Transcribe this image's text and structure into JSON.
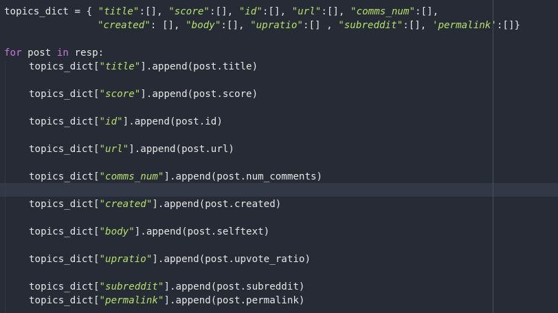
{
  "editor": {
    "lines": [
      {
        "segments": [
          {
            "t": "topics_dict = { ",
            "c": "var"
          },
          {
            "t": "\"title\"",
            "c": "str"
          },
          {
            "t": ":[], ",
            "c": "var"
          },
          {
            "t": "\"score\"",
            "c": "str"
          },
          {
            "t": ":[], ",
            "c": "var"
          },
          {
            "t": "\"id\"",
            "c": "str"
          },
          {
            "t": ":[], ",
            "c": "var"
          },
          {
            "t": "\"url\"",
            "c": "str"
          },
          {
            "t": ":[], ",
            "c": "var"
          },
          {
            "t": "\"comms_num\"",
            "c": "str"
          },
          {
            "t": ":[],",
            "c": "var"
          }
        ]
      },
      {
        "segments": [
          {
            "t": "\"created\"",
            "c": "str"
          },
          {
            "t": ": [], ",
            "c": "var"
          },
          {
            "t": "\"body\"",
            "c": "str"
          },
          {
            "t": ":[], ",
            "c": "var"
          },
          {
            "t": "\"upratio\"",
            "c": "str"
          },
          {
            "t": ":[] , ",
            "c": "var"
          },
          {
            "t": "\"subreddit\"",
            "c": "str"
          },
          {
            "t": ":[], ",
            "c": "var"
          },
          {
            "t": "'permalink'",
            "c": "str"
          },
          {
            "t": ":[]}",
            "c": "var"
          }
        ]
      },
      {
        "segments": [
          {
            "t": "for",
            "c": "kw"
          },
          {
            "t": " post ",
            "c": "var"
          },
          {
            "t": "in",
            "c": "kw"
          },
          {
            "t": " resp:",
            "c": "var"
          }
        ]
      },
      {
        "segments": [
          {
            "t": "topics_dict[",
            "c": "var"
          },
          {
            "t": "\"title\"",
            "c": "str"
          },
          {
            "t": "].append(post.title)",
            "c": "var"
          }
        ]
      },
      {
        "segments": [
          {
            "t": "topics_dict[",
            "c": "var"
          },
          {
            "t": "\"score\"",
            "c": "str"
          },
          {
            "t": "].append(post.score)",
            "c": "var"
          }
        ]
      },
      {
        "segments": [
          {
            "t": "topics_dict[",
            "c": "var"
          },
          {
            "t": "\"id\"",
            "c": "str"
          },
          {
            "t": "].append(post.id)",
            "c": "var"
          }
        ]
      },
      {
        "segments": [
          {
            "t": "topics_dict[",
            "c": "var"
          },
          {
            "t": "\"url\"",
            "c": "str"
          },
          {
            "t": "].append(post.url)",
            "c": "var"
          }
        ]
      },
      {
        "segments": [
          {
            "t": "topics_dict[",
            "c": "var"
          },
          {
            "t": "\"comms_num\"",
            "c": "str"
          },
          {
            "t": "].append(post.num_comments)",
            "c": "var"
          }
        ]
      },
      {
        "segments": [
          {
            "t": "topics_dict[",
            "c": "var"
          },
          {
            "t": "\"created\"",
            "c": "str"
          },
          {
            "t": "].append(post.created)",
            "c": "var"
          }
        ]
      },
      {
        "segments": [
          {
            "t": "topics_dict[",
            "c": "var"
          },
          {
            "t": "\"body\"",
            "c": "str"
          },
          {
            "t": "].append(post.selftext)",
            "c": "var"
          }
        ]
      },
      {
        "segments": [
          {
            "t": "topics_dict[",
            "c": "var"
          },
          {
            "t": "\"upratio\"",
            "c": "str"
          },
          {
            "t": "].append(post.upvote_ratio)",
            "c": "var"
          }
        ]
      },
      {
        "segments": [
          {
            "t": "topics_dict[",
            "c": "var"
          },
          {
            "t": "\"subreddit\"",
            "c": "str"
          },
          {
            "t": "].append(post.subreddit)",
            "c": "var"
          }
        ]
      },
      {
        "segments": [
          {
            "t": "topics_dict[",
            "c": "var"
          },
          {
            "t": "\"permalink\"",
            "c": "str"
          },
          {
            "t": "].append(post.permalink)",
            "c": "var"
          }
        ]
      }
    ],
    "colors": {
      "background": "#262b36",
      "current_line": "#323845",
      "string": "#b5e06a",
      "keyword": "#c678dd",
      "text": "#e6e6e6"
    }
  }
}
